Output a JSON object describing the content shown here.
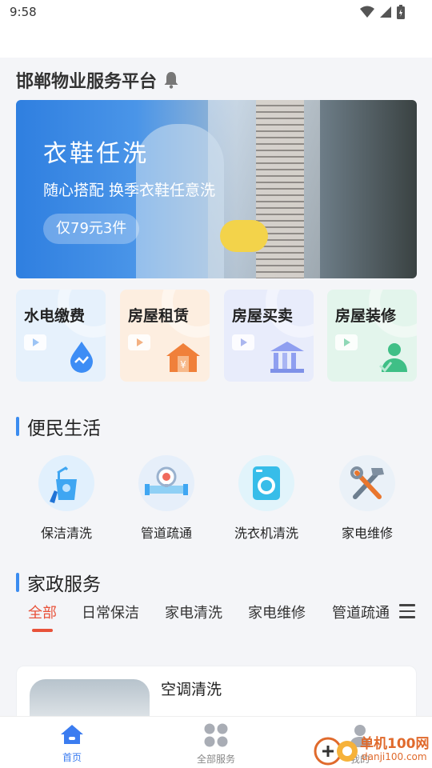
{
  "status_bar": {
    "time": "9:58"
  },
  "header": {
    "title": "邯郸物业服务平台"
  },
  "banner": {
    "headline": "衣鞋任洗",
    "subtitle": "随心搭配 换季衣鞋任意洗",
    "price_pill": "仅79元3件"
  },
  "quick_cards": [
    {
      "label": "水电缴费",
      "color": "#e6f1fc",
      "accent": "#3d8df5"
    },
    {
      "label": "房屋租赁",
      "color": "#fdeee0",
      "accent": "#f0803a"
    },
    {
      "label": "房屋买卖",
      "color": "#e8ecfb",
      "accent": "#7f91e8"
    },
    {
      "label": "房屋装修",
      "color": "#e3f5ec",
      "accent": "#3fbf86"
    }
  ],
  "section_convenience": {
    "title": "便民生活"
  },
  "services": [
    {
      "label": "保洁清洗",
      "icon": "cleaning-bucket-icon"
    },
    {
      "label": "管道疏通",
      "icon": "pipe-icon"
    },
    {
      "label": "洗衣机清洗",
      "icon": "washing-machine-icon"
    },
    {
      "label": "家电维修",
      "icon": "hammer-wrench-icon"
    }
  ],
  "section_housekeeping": {
    "title": "家政服务"
  },
  "tabs": [
    "全部",
    "日常保洁",
    "家电清洗",
    "家电维修",
    "管道疏通"
  ],
  "active_tab": "全部",
  "list": [
    {
      "title": "空调清洗"
    }
  ],
  "bottom_nav": [
    {
      "label": "首页",
      "icon": "home-icon",
      "active": true
    },
    {
      "label": "全部服务",
      "icon": "grid-icon",
      "active": false
    },
    {
      "label": "我的",
      "icon": "user-icon",
      "active": false
    }
  ],
  "watermark": {
    "line1": "单机100网",
    "line2": "danji100.com"
  },
  "colors": {
    "accent_blue": "#3b8cf0",
    "tab_active": "#e8523a"
  }
}
